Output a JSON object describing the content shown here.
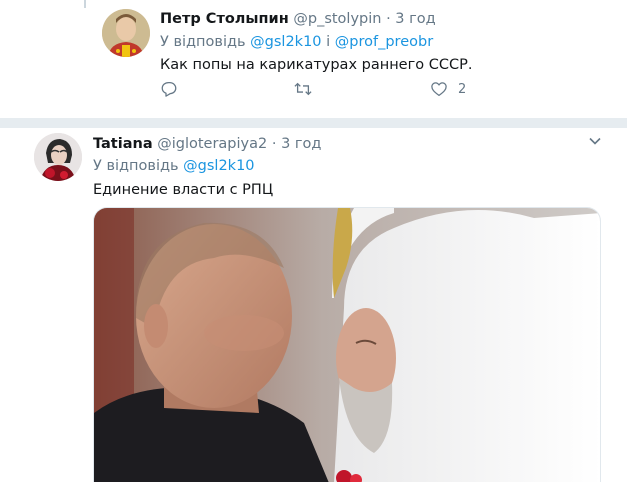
{
  "tweet1": {
    "name": "Петр Столыпин",
    "handle": "@p_stolypin",
    "dot": "·",
    "time": "3 год",
    "reply_prefix": "У відповідь",
    "mention1": "@gsl2k10",
    "reply_join": "і",
    "mention2": "@prof_preobr",
    "text": "Как попы на карикатурах раннего СССР.",
    "like_count": "2"
  },
  "tweet2": {
    "name": "Tatiana",
    "handle": "@igloterapiya2",
    "dot": "·",
    "time": "3 год",
    "reply_prefix": "У відповідь",
    "mention1": "@gsl2k10",
    "text": "Единение власти с РПЦ"
  },
  "icons": {
    "reply": "reply-icon",
    "retweet": "retweet-icon",
    "like": "heart-icon",
    "caret": "chevron-down-icon"
  },
  "colors": {
    "link": "#1b95e0",
    "secondary": "#657786",
    "separator": "#e6ecf0"
  }
}
